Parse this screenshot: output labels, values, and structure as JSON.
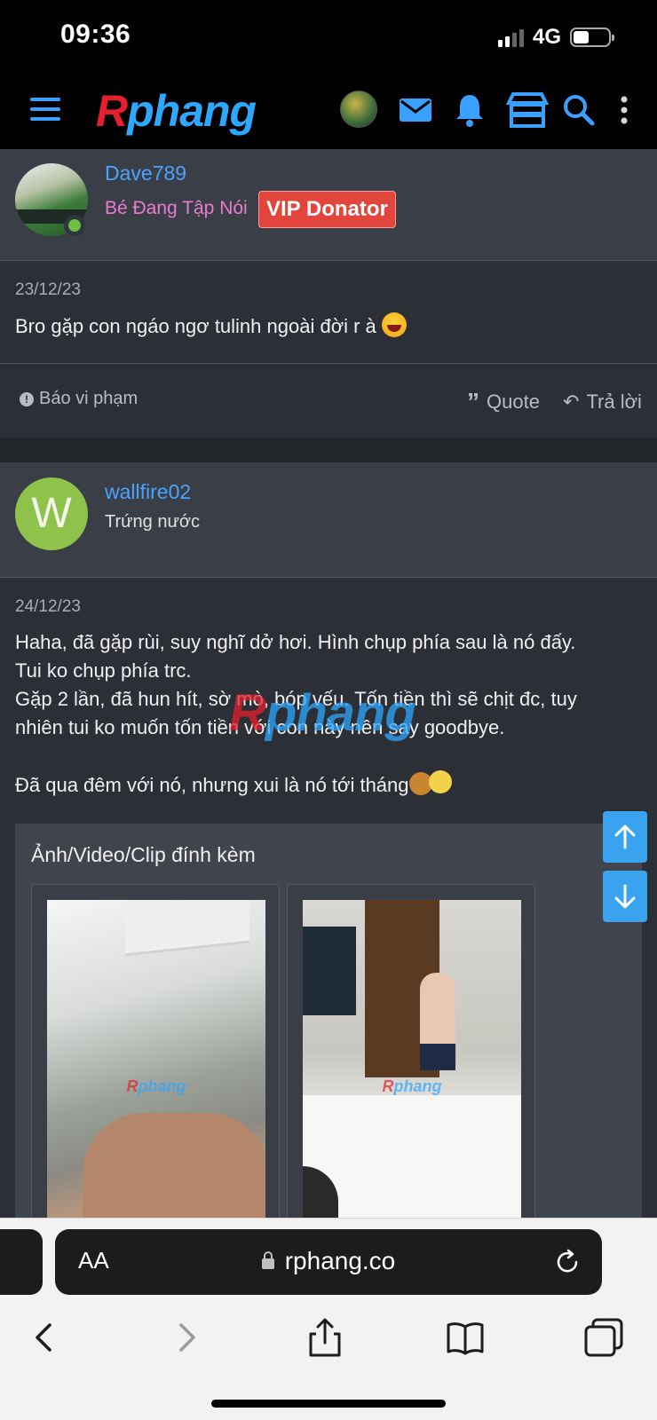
{
  "status_bar": {
    "time": "09:36",
    "network": "4G",
    "battery_percent": 45
  },
  "header": {
    "logo_first": "R",
    "logo_rest": "phang",
    "icons": [
      "menu-icon",
      "user-avatar",
      "mail-icon",
      "bell-icon",
      "store-icon",
      "search-icon",
      "more-vertical-icon"
    ]
  },
  "posts": [
    {
      "username": "Dave789",
      "user_title": "Bé Đang Tập Nói",
      "badge": "VIP Donator",
      "date": "23/12/23",
      "body": "Bro gặp con ngáo ngơ tulinh ngoài đời r à",
      "actions": {
        "report": "Báo vi phạm",
        "quote": "Quote",
        "reply": "Trả lời"
      }
    },
    {
      "avatar_letter": "W",
      "username": "wallfire02",
      "user_title": "Trứng nước",
      "date": "24/12/23",
      "body_lines": [
        "Haha, đã gặp rùi, suy nghĩ dở hơi. Hình chụp phía sau là nó đấy.",
        "Tui ko chụp phía trc.",
        "Gặp 2 lần, đã hun hít, sờ mò, bóp vếu. Tốn tiền thì sẽ chịt đc, tuy",
        "nhiên tui ko muốn tốn tiền với con này nên say goodbye.",
        "Đã qua đêm với nó, nhưng xui là nó tới tháng"
      ],
      "attachments_title": "Ảnh/Video/Clip đính kèm",
      "attachment_count": 2
    }
  ],
  "browser": {
    "aa_label": "AA",
    "url": "rphang.co"
  },
  "colors": {
    "accent": "#3aa0ff",
    "vip": "#e2453b",
    "pink_title": "#e87ccf",
    "username": "#4aa3ff"
  }
}
